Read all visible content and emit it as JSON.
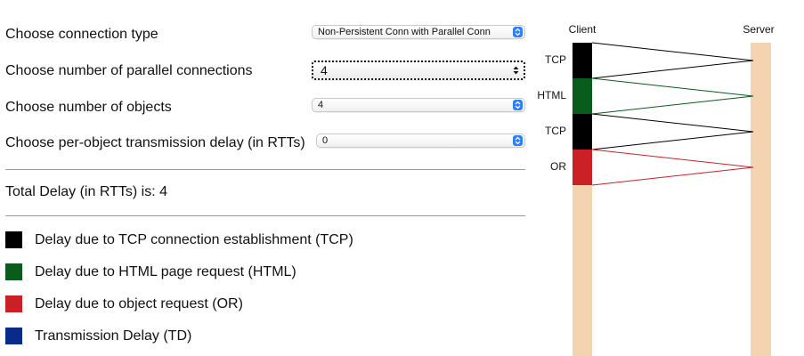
{
  "controls": {
    "connection_type": {
      "label": "Choose connection type",
      "selected": "Non-Persistent Conn with Parallel Conn"
    },
    "parallel_connections": {
      "label": "Choose number of parallel connections",
      "selected": "4"
    },
    "objects": {
      "label": "Choose number of objects",
      "selected": "4"
    },
    "transmission_delay": {
      "label": "Choose per-object transmission delay (in RTTs)",
      "selected": "0"
    }
  },
  "result": {
    "total_delay_text": "Total Delay (in RTTs) is: 4"
  },
  "legend": [
    {
      "label": "Delay due to TCP connection establishment (TCP)",
      "color": "#000000"
    },
    {
      "label": "Delay due to HTML page request (HTML)",
      "color": "#0a5c1c"
    },
    {
      "label": "Delay due to object request (OR)",
      "color": "#cc2027"
    },
    {
      "label": "Transmission Delay (TD)",
      "color": "#0a2a8a"
    }
  ],
  "diagram": {
    "client_label": "Client",
    "server_label": "Server",
    "timeline_color": "#f3d3b0",
    "segments": [
      {
        "label": "TCP",
        "color": "#000000"
      },
      {
        "label": "HTML",
        "color": "#0a5c1c"
      },
      {
        "label": "TCP",
        "color": "#000000"
      },
      {
        "label": "OR",
        "color": "#cc2027"
      }
    ]
  }
}
